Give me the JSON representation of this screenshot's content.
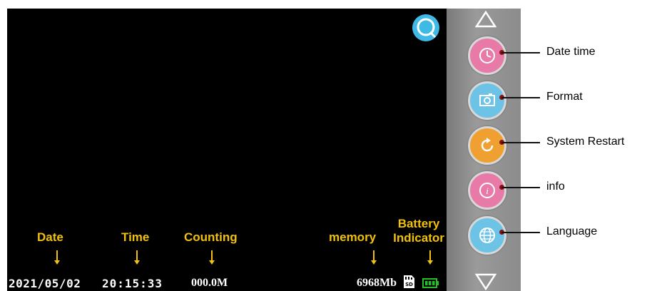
{
  "side_menu": {
    "items": [
      {
        "label": "Date time",
        "icon": "clock-icon",
        "color": "#e87aa8"
      },
      {
        "label": "Format",
        "icon": "camera-icon",
        "color": "#6cc3e6"
      },
      {
        "label": "System Restart",
        "icon": "restart-icon",
        "color": "#f0a030"
      },
      {
        "label": "info",
        "icon": "info-icon",
        "color": "#e87aa8"
      },
      {
        "label": "Language",
        "icon": "globe-icon",
        "color": "#6cc3e6"
      }
    ]
  },
  "status_bar": {
    "date": "2021/05/02",
    "time": "20:15:33",
    "counting": "000.0M",
    "memory": "6968Mb"
  },
  "annotations": {
    "date": "Date",
    "time": "Time",
    "counting": "Counting",
    "memory": "memory",
    "battery_line1": "Battery",
    "battery_line2": "Indicator"
  },
  "colors": {
    "annotation": "#f2c10a",
    "search_button": "#3fb9e6",
    "battery": "#22c022"
  }
}
